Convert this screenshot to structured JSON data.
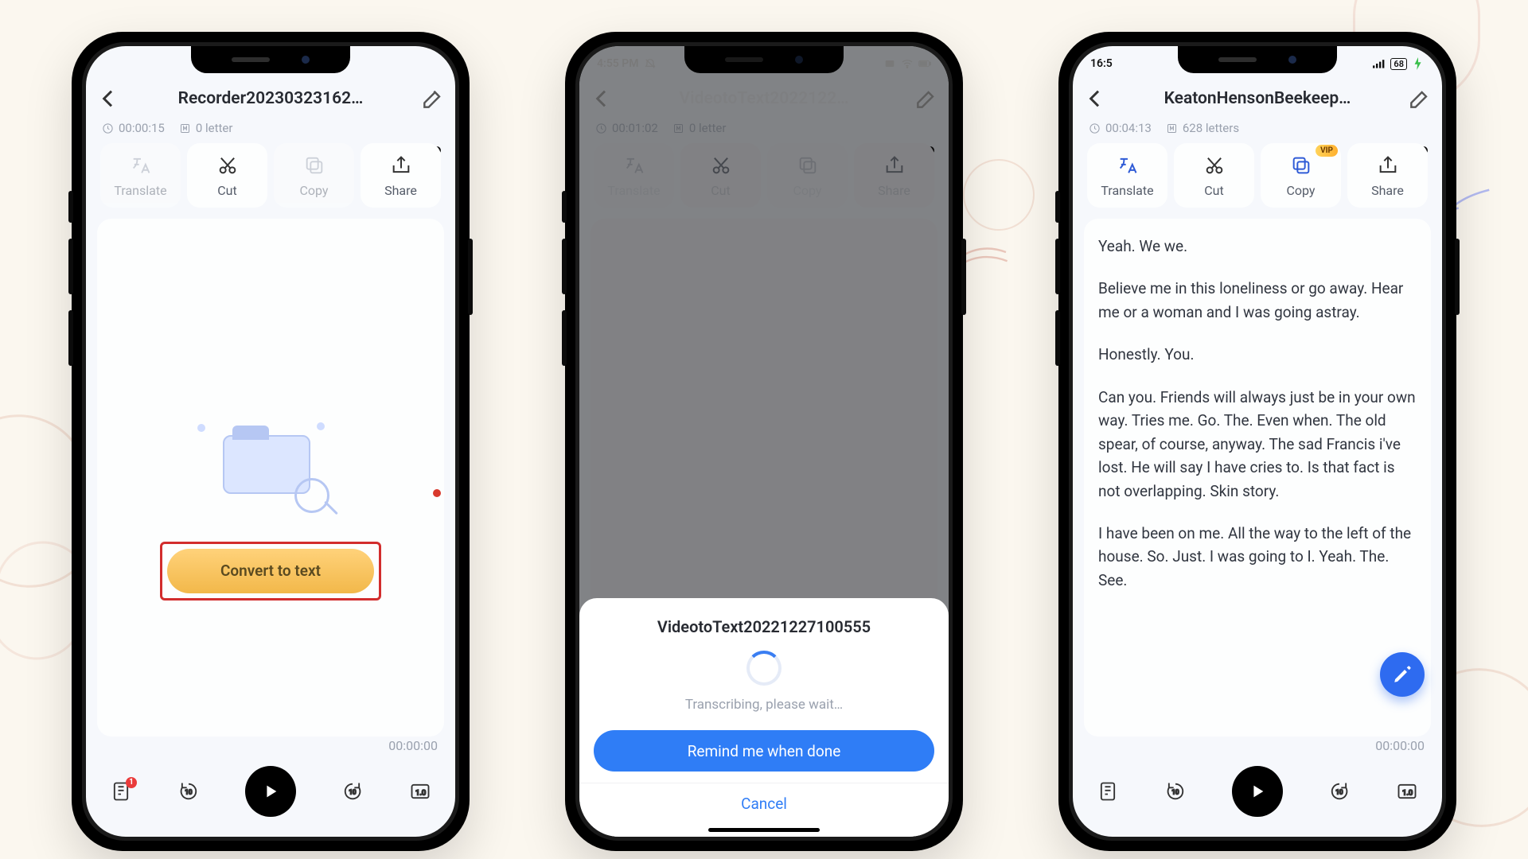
{
  "decorations": {
    "enabled": true
  },
  "phones": {
    "p1": {
      "statusbar": null,
      "title": "Recorder20230323162…",
      "duration": "00:00:15",
      "letters": "0 letter",
      "actions": {
        "translate": "Translate",
        "cut": "Cut",
        "copy": "Copy",
        "share": "Share"
      },
      "convert_label": "Convert to text",
      "timecode": "00:00:00",
      "notif_badge": "1"
    },
    "p2": {
      "status_time": "4:55 PM",
      "title": "VideotoText2022122…",
      "duration": "00:01:02",
      "letters": "0 letter",
      "actions": {
        "translate": "Translate",
        "cut": "Cut",
        "copy": "Copy",
        "share": "Share"
      },
      "modal": {
        "title": "VideotoText20221227100555",
        "subtitle": "Transcribing, please wait…",
        "remind": "Remind me when done",
        "cancel": "Cancel"
      }
    },
    "p3": {
      "status_time": "16:5",
      "status_batt": "68",
      "title": "KeatonHensonBeekeep…",
      "duration": "00:04:13",
      "letters": "628 letters",
      "actions": {
        "translate": "Translate",
        "cut": "Cut",
        "copy": "Copy",
        "share": "Share"
      },
      "vip": "VIP",
      "transcript": {
        "p1": "Yeah. We we.",
        "p2": "Believe me in this loneliness or go away. Hear me or a woman and I was going astray.",
        "p3": "Honestly. You.",
        "p4": "Can you. Friends will always just be in your own way. Tries me. Go. The. Even when. The old spear, of course, anyway. The sad Francis i've lost. He will say I have cries to. Is that fact is not overlapping. Skin story.",
        "p5": "I have been on me. All the way to the left of the house. So. Just. I was going to       I. Yeah. The. See."
      },
      "timecode": "00:00:00"
    }
  }
}
